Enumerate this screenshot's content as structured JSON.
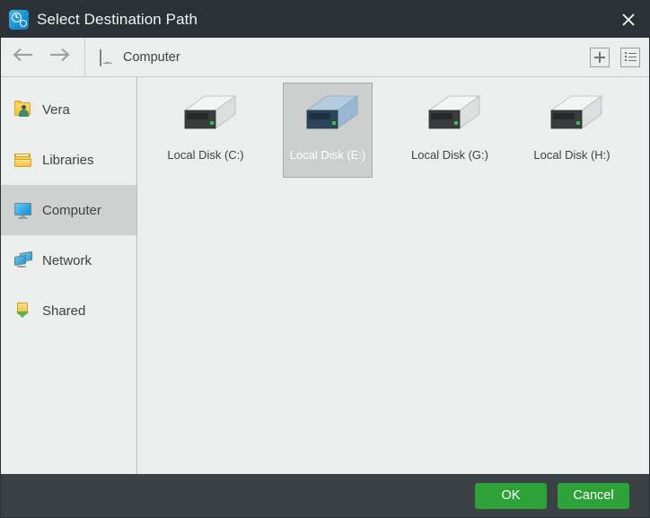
{
  "window": {
    "title": "Select Destination Path",
    "app_icon": "clock-gear-icon",
    "close_icon": "close-icon",
    "titlebar_color": "#2b3136"
  },
  "toolbar": {
    "back_icon": "arrow-left-icon",
    "forward_icon": "arrow-right-icon",
    "breadcrumb_icon": "computer-monitor-icon",
    "breadcrumb_label": "Computer",
    "new_folder_icon": "plus-icon",
    "view_list_icon": "list-view-icon"
  },
  "sidebar": {
    "items": [
      {
        "label": "Vera",
        "icon": "user-folder-icon",
        "selected": false
      },
      {
        "label": "Libraries",
        "icon": "libraries-folder-icon",
        "selected": false
      },
      {
        "label": "Computer",
        "icon": "computer-monitor-icon",
        "selected": true
      },
      {
        "label": "Network",
        "icon": "network-icon",
        "selected": false
      },
      {
        "label": "Shared",
        "icon": "shared-folder-icon",
        "selected": false
      }
    ]
  },
  "content": {
    "drives": [
      {
        "label": "Local Disk (C:)",
        "icon": "hard-drive-icon",
        "selected": false
      },
      {
        "label": "Local Disk (E:)",
        "icon": "hard-drive-icon",
        "selected": true
      },
      {
        "label": "Local Disk (G:)",
        "icon": "hard-drive-icon",
        "selected": false
      },
      {
        "label": "Local Disk (H:)",
        "icon": "hard-drive-icon",
        "selected": false
      }
    ]
  },
  "footer": {
    "ok_label": "OK",
    "cancel_label": "Cancel",
    "button_color": "#2ea239",
    "background_color": "#3a4145"
  }
}
